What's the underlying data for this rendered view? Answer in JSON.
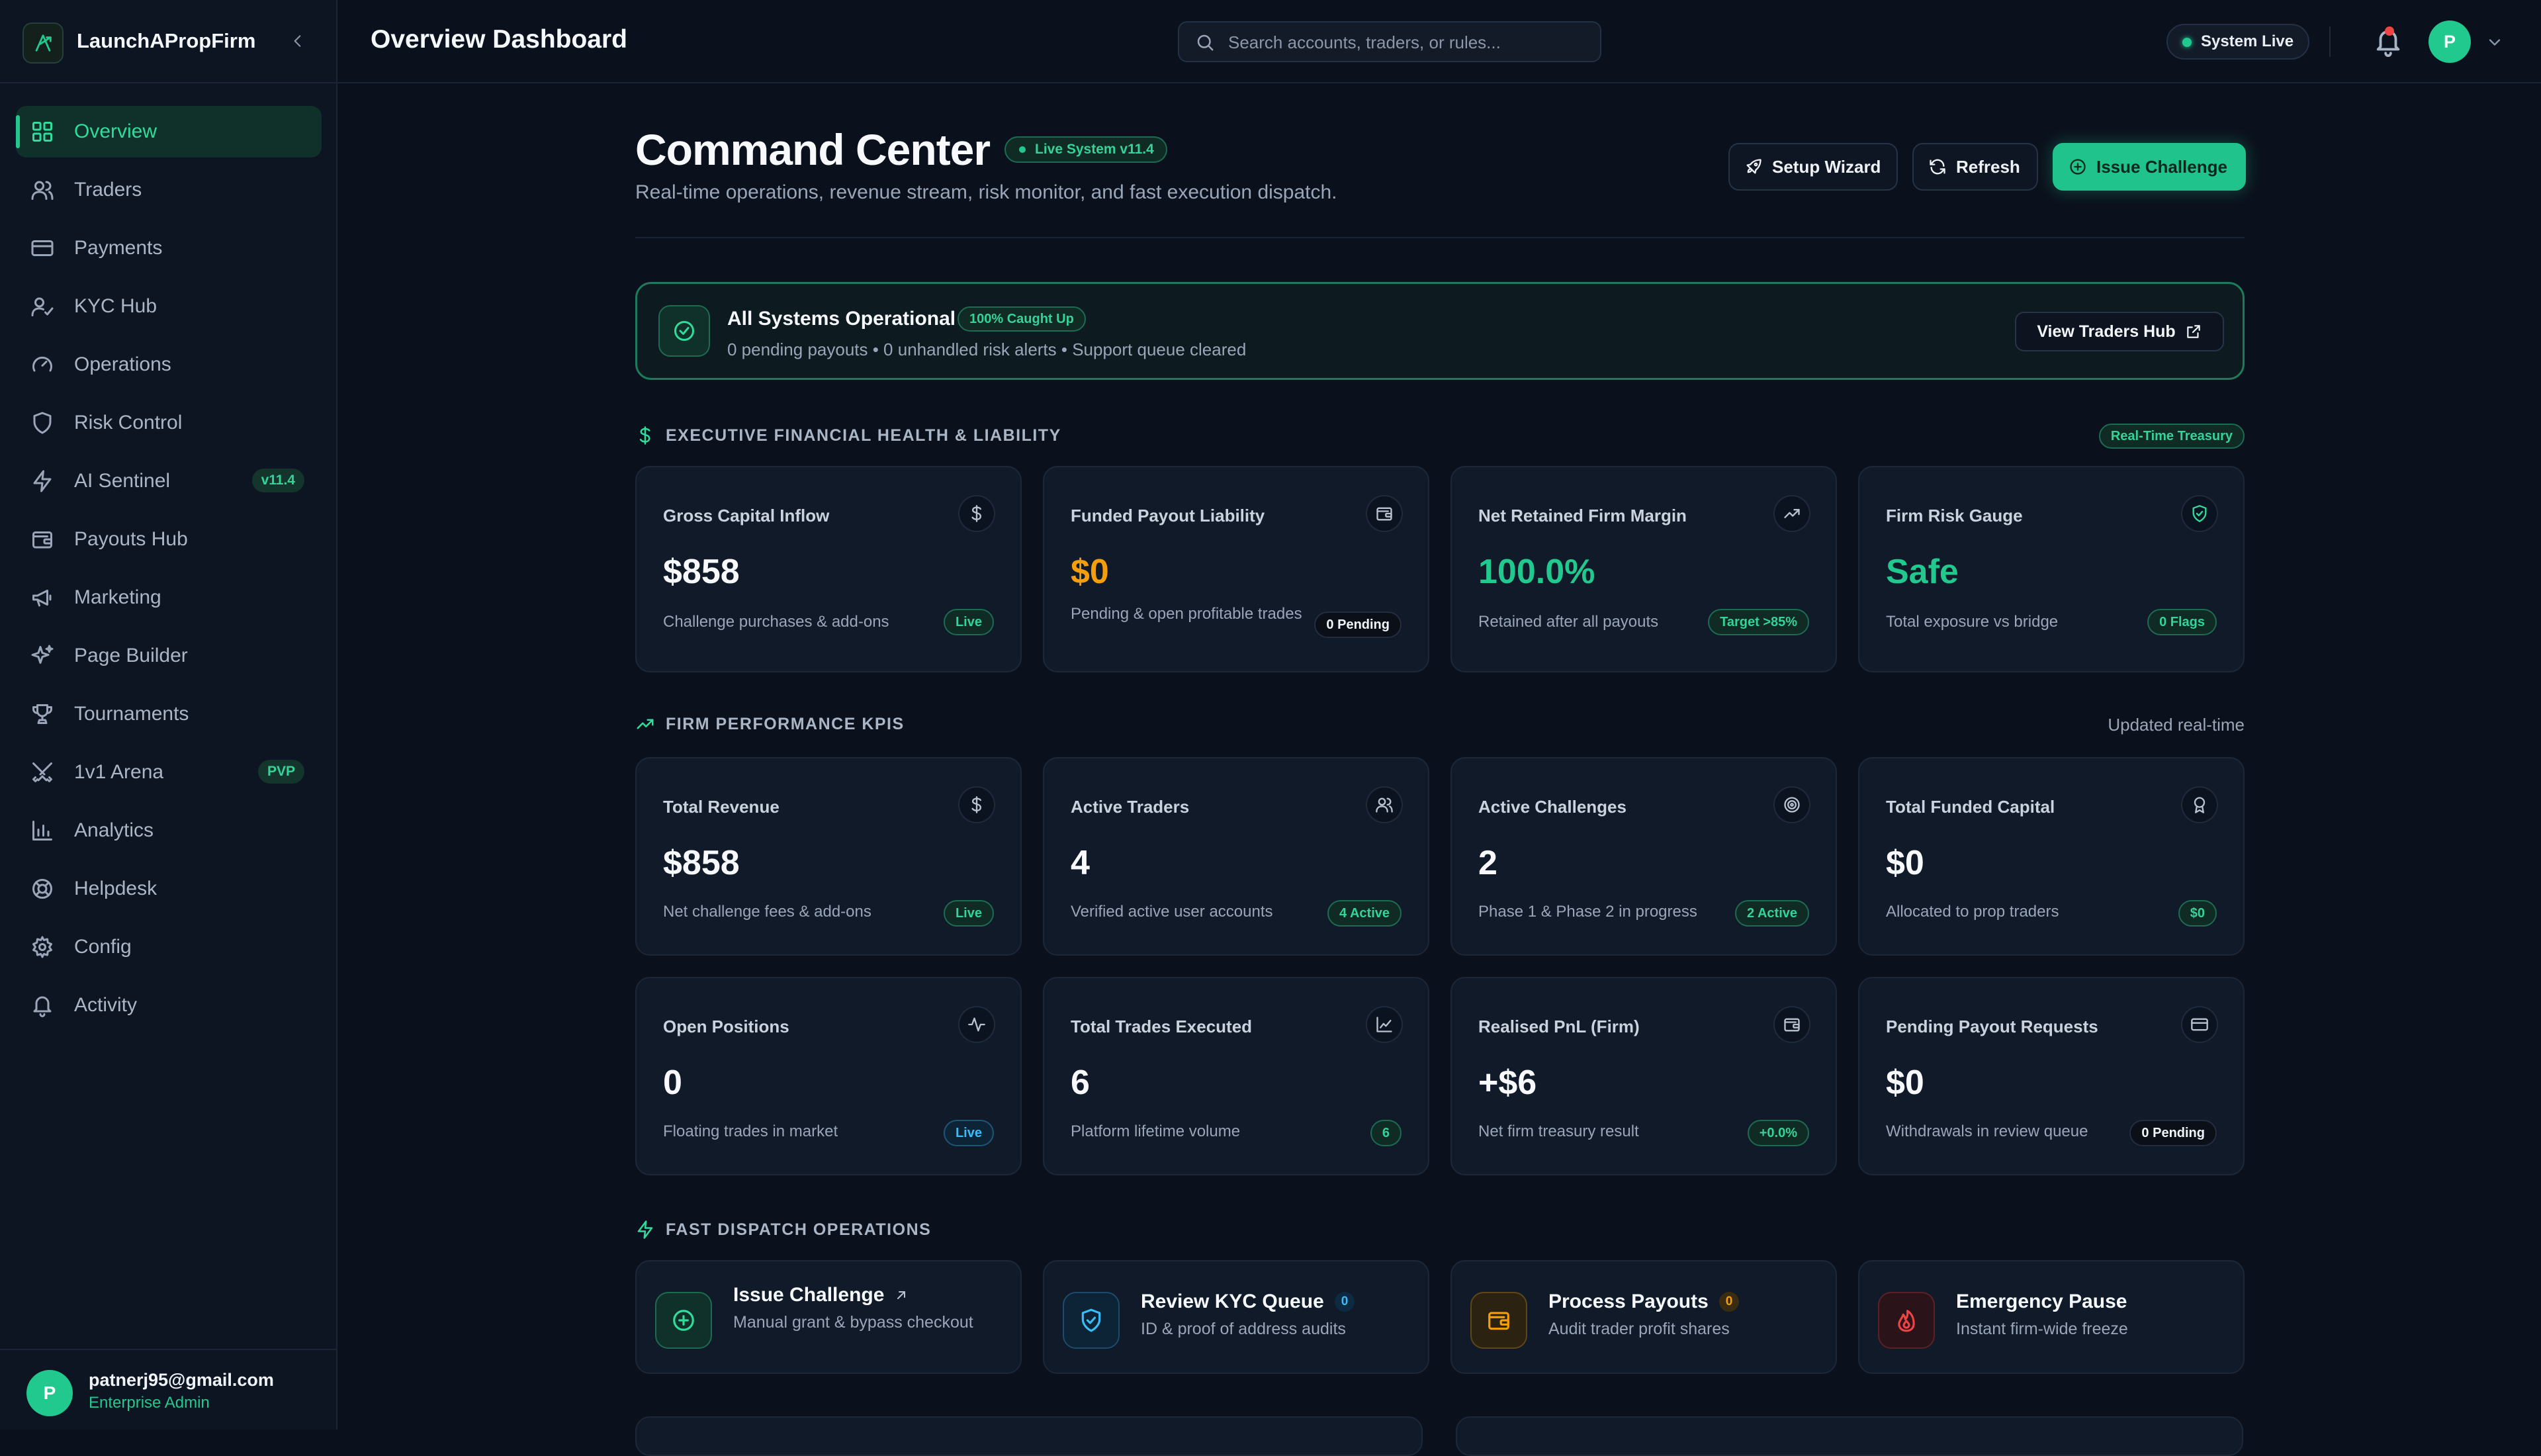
{
  "brand": {
    "name": "LaunchAPropFirm"
  },
  "nav": [
    {
      "label": "Overview",
      "icon": "grid-icon",
      "active": true
    },
    {
      "label": "Traders",
      "icon": "users-icon"
    },
    {
      "label": "Payments",
      "icon": "card-icon"
    },
    {
      "label": "KYC Hub",
      "icon": "user-check-icon"
    },
    {
      "label": "Operations",
      "icon": "gauge-icon"
    },
    {
      "label": "Risk Control",
      "icon": "shield-icon"
    },
    {
      "label": "AI Sentinel",
      "icon": "bolt-icon",
      "badge": "v11.4"
    },
    {
      "label": "Payouts Hub",
      "icon": "wallet-icon"
    },
    {
      "label": "Marketing",
      "icon": "megaphone-icon"
    },
    {
      "label": "Page Builder",
      "icon": "sparkles-icon"
    },
    {
      "label": "Tournaments",
      "icon": "trophy-icon"
    },
    {
      "label": "1v1 Arena",
      "icon": "swords-icon",
      "badge": "PVP"
    },
    {
      "label": "Analytics",
      "icon": "bar-chart-icon"
    },
    {
      "label": "Helpdesk",
      "icon": "lifebuoy-icon"
    },
    {
      "label": "Config",
      "icon": "gear-icon"
    },
    {
      "label": "Activity",
      "icon": "bell-icon"
    }
  ],
  "user": {
    "email": "patnerj95@gmail.com",
    "role": "Enterprise Admin",
    "initial": "P"
  },
  "topbar": {
    "title": "Overview Dashboard",
    "search_placeholder": "Search accounts, traders, or rules...",
    "status": "System Live",
    "avatar_initial": "P"
  },
  "hero": {
    "title": "Command Center",
    "version": "Live System v11.4",
    "subtitle": "Real-time operations, revenue stream, risk monitor, and fast execution dispatch.",
    "setup_label": "Setup Wizard",
    "refresh_label": "Refresh",
    "issue_label": "Issue Challenge"
  },
  "banner": {
    "title": "All Systems Operational",
    "pill": "100% Caught Up",
    "desc": "0 pending payouts • 0 unhandled risk alerts • Support queue cleared",
    "button": "View Traders Hub"
  },
  "financial": {
    "title": "EXECUTIVE FINANCIAL HEALTH & LIABILITY",
    "pill": "Real-Time Treasury",
    "cards": [
      {
        "label": "Gross Capital Inflow",
        "value": "$858",
        "desc": "Challenge purchases & add-ons",
        "badge": "Live"
      },
      {
        "label": "Funded Payout Liability",
        "value": "$0",
        "desc": "Pending & open profitable trades",
        "badge": "0 Pending"
      },
      {
        "label": "Net Retained Firm Margin",
        "value": "100.0%",
        "desc": "Retained after all payouts",
        "badge": "Target >85%"
      },
      {
        "label": "Firm Risk Gauge",
        "value": "Safe",
        "desc": "Total exposure vs bridge",
        "badge": "0 Flags"
      }
    ]
  },
  "kpis": {
    "title": "FIRM PERFORMANCE KPIS",
    "updated": "Updated real-time",
    "cards": [
      {
        "label": "Total Revenue",
        "value": "$858",
        "desc": "Net challenge fees & add-ons",
        "badge": "Live"
      },
      {
        "label": "Active Traders",
        "value": "4",
        "desc": "Verified active user accounts",
        "badge": "4 Active"
      },
      {
        "label": "Active Challenges",
        "value": "2",
        "desc": "Phase 1 & Phase 2 in progress",
        "badge": "2 Active"
      },
      {
        "label": "Total Funded Capital",
        "value": "$0",
        "desc": "Allocated to prop traders",
        "badge": "$0"
      },
      {
        "label": "Open Positions",
        "value": "0",
        "desc": "Floating trades in market",
        "badge": "Live"
      },
      {
        "label": "Total Trades Executed",
        "value": "6",
        "desc": "Platform lifetime volume",
        "badge": "6"
      },
      {
        "label": "Realised PnL (Firm)",
        "value": "+$6",
        "desc": "Net firm treasury result",
        "badge": "+0.0%"
      },
      {
        "label": "Pending Payout Requests",
        "value": "$0",
        "desc": "Withdrawals in review queue",
        "badge": "0 Pending"
      }
    ]
  },
  "dispatch": {
    "title": "FAST DISPATCH OPERATIONS",
    "actions": [
      {
        "title": "Issue Challenge",
        "desc": "Manual grant & bypass checkout"
      },
      {
        "title": "Review KYC Queue",
        "count": "0",
        "desc": "ID & proof of address audits"
      },
      {
        "title": "Process Payouts",
        "count": "0",
        "desc": "Audit trader profit shares"
      },
      {
        "title": "Emergency Pause",
        "desc": "Instant firm-wide freeze"
      }
    ]
  },
  "colors": {
    "accent": "#22c98e",
    "amber": "#f59e0b",
    "danger": "#ef4444",
    "info": "#38bdf8",
    "background": "#0b111c",
    "card": "#111a28"
  }
}
